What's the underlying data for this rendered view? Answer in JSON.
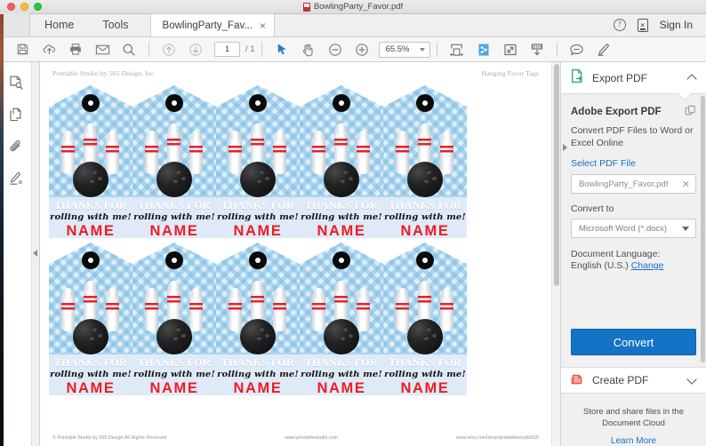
{
  "window": {
    "title": "BowlingParty_Favor.pdf",
    "traffic_lights": [
      "close",
      "minimize",
      "zoom"
    ]
  },
  "tabbar": {
    "home_label": "Home",
    "tools_label": "Tools",
    "doc_tab_label": "BowlingParty_Fav...",
    "close_glyph": "×",
    "help_glyph": "?",
    "device_glyph": "×",
    "sign_in_label": "Sign In"
  },
  "toolbar": {
    "save": "save-icon",
    "upload": "upload-cloud-icon",
    "print": "print-icon",
    "email": "email-icon",
    "search": "search-icon",
    "prev_page": "arrow-up-icon",
    "next_page": "arrow-down-icon",
    "page_value": "1",
    "page_total": "/ 1",
    "select_tool": "cursor-icon",
    "hand_tool": "hand-icon",
    "zoom_out": "minus-icon",
    "zoom_in": "plus-icon",
    "zoom_value": "65.5%",
    "fit_width": "fit-width-icon",
    "fit_page": "fit-page-icon",
    "full_screen": "full-screen-icon",
    "scroll_mode": "scroll-down-icon",
    "comment": "comment-icon",
    "highlight": "highlight-pen-icon"
  },
  "left_rail": {
    "items": [
      {
        "name": "page-thumbnails-icon"
      },
      {
        "name": "pages-icon"
      },
      {
        "name": "attachment-clip-icon"
      },
      {
        "name": "sign-icon"
      }
    ]
  },
  "document": {
    "header_left": "Printable Studio by 505 Design, Inc",
    "header_right": "Hanging Favor Tags",
    "footer_left": "© Printable Studio by 505 Design All Rights Reserved",
    "footer_center": "www.printablestudio.com",
    "footer_right": "www.etsy.com/shop/printablestudio505",
    "tag": {
      "line1": "THANKS FOR",
      "line2": "rolling with me!",
      "line3": "NAME"
    },
    "rows": 2,
    "columns": 5,
    "colors": {
      "tag_blue": "#ddeffb",
      "chevron_blue": "#78b9e1",
      "text_band": "#dfeaf8",
      "name_red": "#ee1d22",
      "pin_stripe_red": "#e8202a"
    }
  },
  "right_panel": {
    "export_section": {
      "header": "Export PDF",
      "icon": "export-pdf-icon",
      "icon_color": "#2aa86e",
      "title": "Adobe Export PDF",
      "copy_icon": "copy-icon",
      "description": "Convert PDF Files to Word or Excel Online",
      "select_file_link": "Select PDF File",
      "file_value": "BowlingParty_Favor.pdf",
      "clear_glyph": "✕",
      "convert_to_label": "Convert to",
      "convert_to_value": "Microsoft Word (*.docx)",
      "language_label": "Document Language:",
      "language_value": "English (U.S.)",
      "language_change_link": "Change",
      "convert_button": "Convert",
      "button_color": "#1473c6"
    },
    "create_section": {
      "header": "Create PDF",
      "icon": "create-pdf-icon",
      "icon_color": "#e8574a"
    },
    "cloud_promo": {
      "line1": "Store and share files in the",
      "line2": "Document Cloud",
      "learn_more": "Learn More"
    }
  }
}
